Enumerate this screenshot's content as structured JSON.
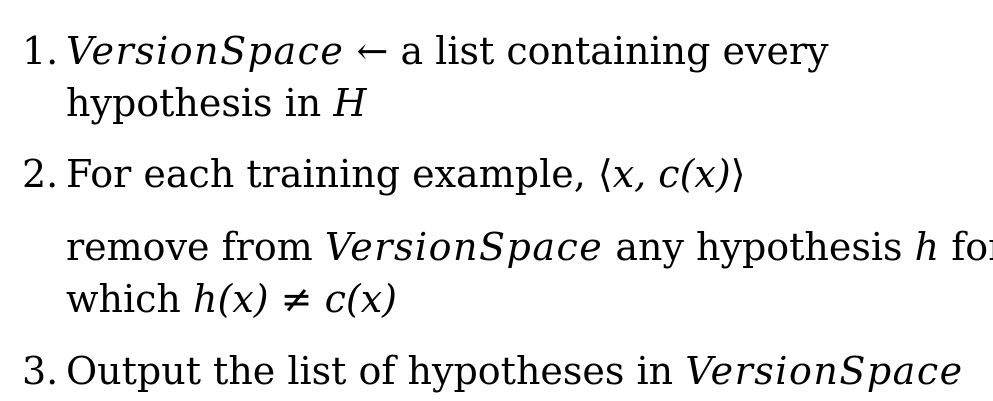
{
  "algorithm": {
    "steps": [
      {
        "number": "1.",
        "lines": [
          {
            "vs": "VersionSpace",
            "arrow": "←",
            "text": "a list containing every"
          },
          {
            "text": "hypothesis in",
            "math": "H"
          }
        ]
      },
      {
        "number": "2.",
        "lines": [
          {
            "text": "For each training example,",
            "langle": "⟨",
            "math": "x, c(x)",
            "rangle": "⟩"
          },
          {
            "text1": "remove from",
            "vs": "VersionSpace",
            "text2": "any hypothesis",
            "math": "h",
            "text3": "for"
          },
          {
            "text": "which",
            "math1": "h(x)",
            "neq": "≠",
            "math2": "c(x)"
          }
        ]
      },
      {
        "number": "3.",
        "lines": [
          {
            "text": "Output the list of hypotheses in",
            "vs": "VersionSpace"
          }
        ]
      }
    ]
  }
}
